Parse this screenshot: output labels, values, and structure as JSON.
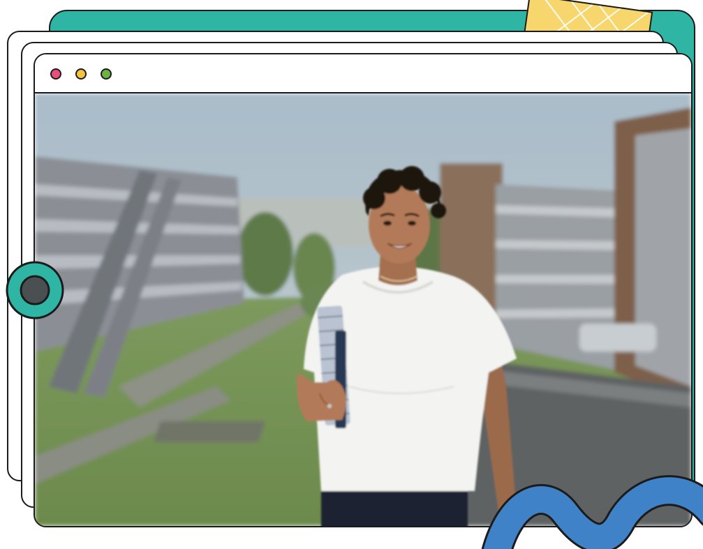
{
  "window": {
    "controls": [
      {
        "name": "close",
        "color": "#e94f7b"
      },
      {
        "name": "minimize",
        "color": "#f4c341"
      },
      {
        "name": "maximize",
        "color": "#6eb144"
      }
    ]
  },
  "photo": {
    "subject": "student-holding-notebooks",
    "background": "blurred-university-campus"
  },
  "decor": {
    "teal": "#2fb5a4",
    "yellow": "#f7d66d",
    "blue": "#3f82c7",
    "outline": "#1b1b1b"
  }
}
